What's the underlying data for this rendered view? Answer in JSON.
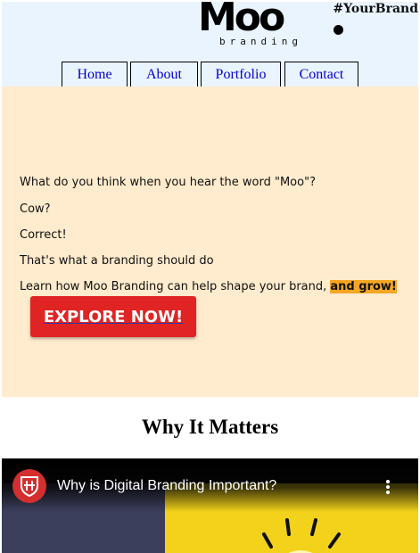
{
  "header": {
    "tagline": "#YourBrand",
    "logo_word": "Moo",
    "logo_sub": "branding"
  },
  "nav": {
    "items": [
      {
        "label": "Home"
      },
      {
        "label": "About"
      },
      {
        "label": "Portfolio"
      },
      {
        "label": "Contact"
      }
    ]
  },
  "hero": {
    "lines": [
      "What do you think when you hear the word \"Moo\"?",
      "Cow?",
      "Correct!",
      "That's what a branding should do"
    ],
    "learn_text": "Learn how Moo Branding can help shape your brand, ",
    "highlight_text": "and grow!",
    "cta_label": "EXPLORE NOW!"
  },
  "section": {
    "title": "Why It Matters"
  },
  "video": {
    "title": "Why is Digital Branding Important?",
    "channel_icon": "shield-logo-icon",
    "menu_icon": "more-vert-icon"
  },
  "colors": {
    "header_bg": "#eaf4ff",
    "hero_bg": "#ffebcd",
    "cta_bg": "#e02424",
    "highlight": "#f5a623",
    "link": "#0000cc"
  }
}
